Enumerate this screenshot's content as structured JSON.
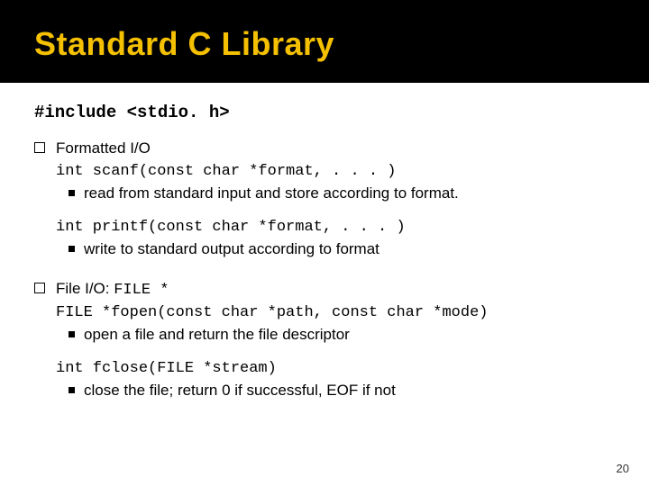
{
  "title": "Standard C Library",
  "include": "#include <stdio. h>",
  "sections": [
    {
      "heading": "Formatted I/O",
      "heading_mono_suffix": "",
      "items": [
        {
          "code": "int scanf(const char *format, . . . )",
          "desc": "read from standard input and store according to format."
        },
        {
          "code": "int printf(const char *format, . . . )",
          "desc": "write to standard output according to format"
        }
      ]
    },
    {
      "heading": "File I/O: ",
      "heading_mono_suffix": "FILE *",
      "items": [
        {
          "code": "FILE *fopen(const char *path, const char *mode)",
          "desc": "open a file and return the file descriptor"
        },
        {
          "code": "int fclose(FILE *stream)",
          "desc": "close the file; return 0 if successful, EOF if not"
        }
      ]
    }
  ],
  "page": "20"
}
